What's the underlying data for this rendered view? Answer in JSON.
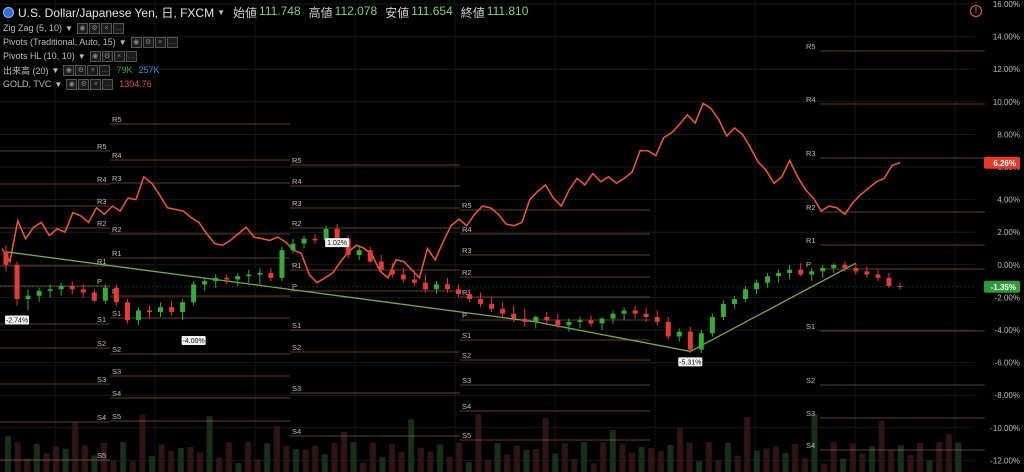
{
  "header": {
    "symbol": "U.S. Dollar/Japanese Yen, 日, FXCM",
    "ohlc": [
      {
        "label": "始値",
        "value": "111.748"
      },
      {
        "label": "高値",
        "value": "112.078"
      },
      {
        "label": "安値",
        "value": "111.654"
      },
      {
        "label": "終値",
        "value": "111.810"
      }
    ]
  },
  "indicators": [
    {
      "id": "zigzag",
      "label": "Zig Zag (5, 10)"
    },
    {
      "id": "pivots",
      "label": "Pivots (Traditional, Auto, 15)"
    },
    {
      "id": "pivotshl",
      "label": "Pivots HL (10, 10)"
    },
    {
      "id": "volume",
      "label": "出来高 (20)",
      "values": [
        "79K",
        "257K"
      ]
    },
    {
      "id": "gold",
      "label": "GOLD, TVC",
      "values": [
        "1304.76"
      ]
    }
  ],
  "colors": {
    "up": "#3aa83a",
    "down": "#e03c3c",
    "gold_line": "#e0583a",
    "zigzag": "#7aa84f",
    "pivot": "#b8784a",
    "axis_text": "#bdbdbd"
  },
  "chart_data": {
    "type": "line",
    "y_axis": {
      "min": -12,
      "max": 16,
      "step": 2,
      "unit": "%",
      "ticks": [
        "16.00%",
        "14.00%",
        "12.00%",
        "10.00%",
        "8.00%",
        "6.00%",
        "4.00%",
        "2.00%",
        "0.00%",
        "-2.00%",
        "-4.00%",
        "-6.00%",
        "-8.00%",
        "-10.00%",
        "-12.00%"
      ]
    },
    "price_label": "-1.35%",
    "price_value": -1.35,
    "gold_label": "6.26%",
    "gold_value": 6.26,
    "gold_series": [
      1.0,
      0.2,
      2.7,
      1.6,
      2.3,
      2.6,
      1.8,
      2.2,
      2.0,
      3.2,
      3.0,
      2.6,
      3.5,
      3.1,
      3.6,
      3.3,
      4.1,
      4.0,
      5.4,
      5.0,
      4.3,
      3.5,
      3.4,
      3.3,
      2.9,
      2.6,
      1.9,
      1.3,
      1.2,
      1.5,
      1.9,
      2.3,
      1.7,
      1.6,
      1.5,
      1.7,
      1.4,
      0.9,
      0.7,
      -0.6,
      -1.1,
      -0.8,
      -0.5,
      0.2,
      0.8,
      1.2,
      1.0,
      0.6,
      -0.4,
      -0.8,
      0.3,
      0.2,
      -0.3,
      -0.8,
      1.0,
      0.3,
      1.4,
      2.4,
      2.8,
      2.4,
      3.1,
      3.6,
      3.5,
      3.1,
      2.5,
      2.4,
      2.6,
      4.0,
      4.5,
      4.9,
      4.1,
      3.6,
      4.6,
      5.3,
      4.9,
      5.6,
      5.1,
      5.4,
      5.0,
      5.3,
      5.7,
      7.0,
      7.0,
      6.7,
      7.8,
      8.1,
      8.6,
      9.2,
      8.7,
      9.9,
      9.6,
      8.9,
      7.9,
      8.4,
      8.0,
      7.2,
      6.3,
      5.8,
      5.0,
      5.4,
      6.4,
      5.4,
      4.6,
      4.1,
      3.3,
      3.6,
      3.5,
      3.1,
      3.8,
      4.3,
      4.7,
      5.1,
      5.3,
      6.1,
      6.26
    ],
    "candles": [
      [
        0.8,
        1.2,
        -0.4,
        0.0
      ],
      [
        0.0,
        0.2,
        -2.5,
        -2.1
      ],
      [
        -2.1,
        -1.5,
        -2.8,
        -1.9
      ],
      [
        -1.9,
        -1.4,
        -2.3,
        -1.6
      ],
      [
        -1.6,
        -1.2,
        -2.0,
        -1.5
      ],
      [
        -1.5,
        -1.1,
        -1.9,
        -1.3
      ],
      [
        -1.3,
        -1.0,
        -1.8,
        -1.5
      ],
      [
        -1.5,
        -1.2,
        -2.0,
        -1.7
      ],
      [
        -1.7,
        -1.5,
        -2.3,
        -2.2
      ],
      [
        -2.2,
        -1.2,
        -2.4,
        -1.4
      ],
      [
        -1.4,
        -1.2,
        -2.5,
        -2.3
      ],
      [
        -2.3,
        -2.1,
        -3.6,
        -3.4
      ],
      [
        -3.4,
        -2.6,
        -3.7,
        -2.8
      ],
      [
        -2.8,
        -2.5,
        -3.3,
        -2.9
      ],
      [
        -2.9,
        -2.3,
        -3.2,
        -2.6
      ],
      [
        -2.6,
        -2.2,
        -3.1,
        -2.9
      ],
      [
        -2.9,
        -2.1,
        -3.4,
        -2.3
      ],
      [
        -2.3,
        -1.0,
        -2.5,
        -1.2
      ],
      [
        -1.2,
        -0.8,
        -1.6,
        -1.0
      ],
      [
        -1.0,
        -0.6,
        -1.4,
        -0.8
      ],
      [
        -0.8,
        -0.6,
        -1.2,
        -0.9
      ],
      [
        -0.9,
        -0.5,
        -1.3,
        -0.7
      ],
      [
        -0.7,
        -0.3,
        -1.1,
        -0.6
      ],
      [
        -0.6,
        -0.2,
        -1.2,
        -0.5
      ],
      [
        -0.5,
        -0.2,
        -1.0,
        -0.8
      ],
      [
        -0.8,
        1.1,
        -1.0,
        0.9
      ],
      [
        0.9,
        1.6,
        0.7,
        1.3
      ],
      [
        1.3,
        1.8,
        1.0,
        1.6
      ],
      [
        1.6,
        1.9,
        1.3,
        1.5
      ],
      [
        1.5,
        2.4,
        1.4,
        2.2
      ],
      [
        2.2,
        2.5,
        1.5,
        1.6
      ],
      [
        1.6,
        1.8,
        0.4,
        0.6
      ],
      [
        0.6,
        1.2,
        0.3,
        0.9
      ],
      [
        0.9,
        1.1,
        0.1,
        0.2
      ],
      [
        0.2,
        0.6,
        -0.5,
        -0.3
      ],
      [
        -0.3,
        0.1,
        -0.8,
        -0.6
      ],
      [
        -0.6,
        -0.2,
        -1.1,
        -0.9
      ],
      [
        -0.9,
        -0.4,
        -1.3,
        -1.1
      ],
      [
        -1.1,
        -0.6,
        -1.7,
        -1.5
      ],
      [
        -1.5,
        -1.0,
        -1.8,
        -1.2
      ],
      [
        -1.2,
        -0.8,
        -1.7,
        -1.5
      ],
      [
        -1.5,
        -1.2,
        -2.0,
        -1.8
      ],
      [
        -1.8,
        -1.5,
        -2.3,
        -2.1
      ],
      [
        -2.1,
        -1.7,
        -2.6,
        -2.4
      ],
      [
        -2.4,
        -2.0,
        -2.9,
        -2.7
      ],
      [
        -2.7,
        -2.3,
        -3.2,
        -3.0
      ],
      [
        -3.0,
        -2.5,
        -3.5,
        -3.3
      ],
      [
        -3.3,
        -2.7,
        -3.8,
        -3.5
      ],
      [
        -3.5,
        -3.1,
        -3.9,
        -3.2
      ],
      [
        -3.2,
        -2.9,
        -3.7,
        -3.4
      ],
      [
        -3.4,
        -3.0,
        -3.9,
        -3.7
      ],
      [
        -3.7,
        -3.3,
        -4.1,
        -3.5
      ],
      [
        -3.5,
        -3.2,
        -3.9,
        -3.4
      ],
      [
        -3.4,
        -3.1,
        -3.8,
        -3.6
      ],
      [
        -3.6,
        -3.2,
        -4.0,
        -3.3
      ],
      [
        -3.3,
        -2.8,
        -3.6,
        -3.0
      ],
      [
        -3.0,
        -2.6,
        -3.4,
        -2.8
      ],
      [
        -2.8,
        -2.5,
        -3.3,
        -3.0
      ],
      [
        -3.0,
        -2.6,
        -3.5,
        -3.2
      ],
      [
        -3.2,
        -2.8,
        -3.7,
        -3.5
      ],
      [
        -3.5,
        -3.2,
        -4.6,
        -4.4
      ],
      [
        -4.4,
        -3.9,
        -4.7,
        -4.1
      ],
      [
        -4.1,
        -3.8,
        -5.4,
        -5.2
      ],
      [
        -5.2,
        -4.0,
        -5.4,
        -4.2
      ],
      [
        -4.2,
        -3.0,
        -4.4,
        -3.2
      ],
      [
        -3.2,
        -2.2,
        -3.4,
        -2.4
      ],
      [
        -2.4,
        -1.9,
        -2.7,
        -2.1
      ],
      [
        -2.1,
        -1.3,
        -2.3,
        -1.5
      ],
      [
        -1.5,
        -0.9,
        -1.8,
        -1.1
      ],
      [
        -1.1,
        -0.5,
        -1.4,
        -0.7
      ],
      [
        -0.7,
        -0.3,
        -1.1,
        -0.5
      ],
      [
        -0.5,
        0.0,
        -0.9,
        -0.3
      ],
      [
        -0.3,
        0.1,
        -0.7,
        -0.6
      ],
      [
        -0.6,
        -0.2,
        -1.0,
        -0.4
      ],
      [
        -0.4,
        0.0,
        -0.8,
        -0.2
      ],
      [
        -0.2,
        0.1,
        -0.5,
        0.0
      ],
      [
        0.0,
        0.2,
        -0.4,
        -0.2
      ],
      [
        -0.2,
        0.1,
        -0.6,
        -0.4
      ],
      [
        -0.4,
        -0.1,
        -0.8,
        -0.6
      ],
      [
        -0.6,
        -0.3,
        -1.0,
        -0.8
      ],
      [
        -0.8,
        -0.5,
        -1.4,
        -1.3
      ],
      [
        -1.3,
        -1.1,
        -1.5,
        -1.35
      ]
    ],
    "zigzag_labels": [
      {
        "text": "-2.74%",
        "value": -2.74
      },
      {
        "text": "-4.00%",
        "value": -4.0
      },
      {
        "text": "1.02%",
        "value": 1.02
      },
      {
        "text": "-5.31%",
        "value": -5.31
      }
    ],
    "pivot_blocks": [
      {
        "labels": [
          "R5",
          "R4",
          "R3",
          "R2",
          "R1",
          "P",
          "S1",
          "S2",
          "S3",
          "S4",
          "S5"
        ]
      },
      {
        "labels": [
          "R5",
          "R4",
          "R3",
          "R2",
          "R1",
          "P",
          "S1",
          "S2",
          "S3",
          "S4",
          "S5"
        ]
      },
      {
        "labels": [
          "R5",
          "R4",
          "R3",
          "R2",
          "R1",
          "P",
          "S1",
          "S2",
          "S3",
          "S4"
        ]
      },
      {
        "labels": [
          "R5",
          "R4",
          "R3",
          "R2",
          "R1",
          "P",
          "S1",
          "S2",
          "S3",
          "S4",
          "S5"
        ]
      },
      {
        "labels": [
          "R5",
          "R4",
          "R3",
          "R2",
          "R1",
          "P",
          "S1",
          "S2",
          "S3",
          "S4"
        ]
      }
    ]
  }
}
